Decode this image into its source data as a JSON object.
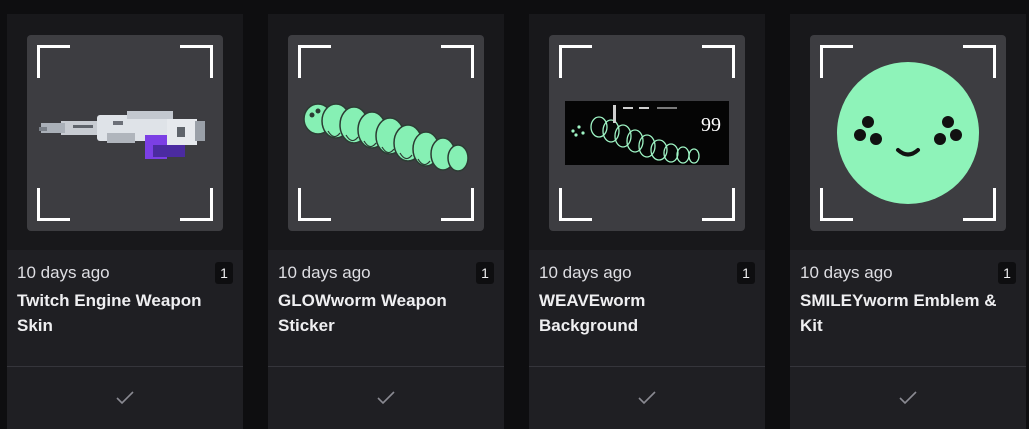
{
  "cards": [
    {
      "time": "10 days ago",
      "count": "1",
      "title": "Twitch Engine Weapon Skin",
      "image_icon": "weapon-skin-image",
      "claimed": true
    },
    {
      "time": "10 days ago",
      "count": "1",
      "title": "GLOWworm Weapon Sticker",
      "image_icon": "glowworm-sticker-image",
      "claimed": true
    },
    {
      "time": "10 days ago",
      "count": "1",
      "title": "WEAVEworm Background",
      "image_icon": "weaveworm-background-image",
      "background_number": "99",
      "claimed": true
    },
    {
      "time": "10 days ago",
      "count": "1",
      "title": "SMILEYworm Emblem & Kit",
      "image_icon": "smileyworm-emblem-image",
      "claimed": true
    }
  ],
  "colors": {
    "card_bg": "#1f1f23",
    "frame_bg": "#3d3d41",
    "worm_green": "#86f0b4",
    "smiley_green": "#8ef3b9"
  }
}
